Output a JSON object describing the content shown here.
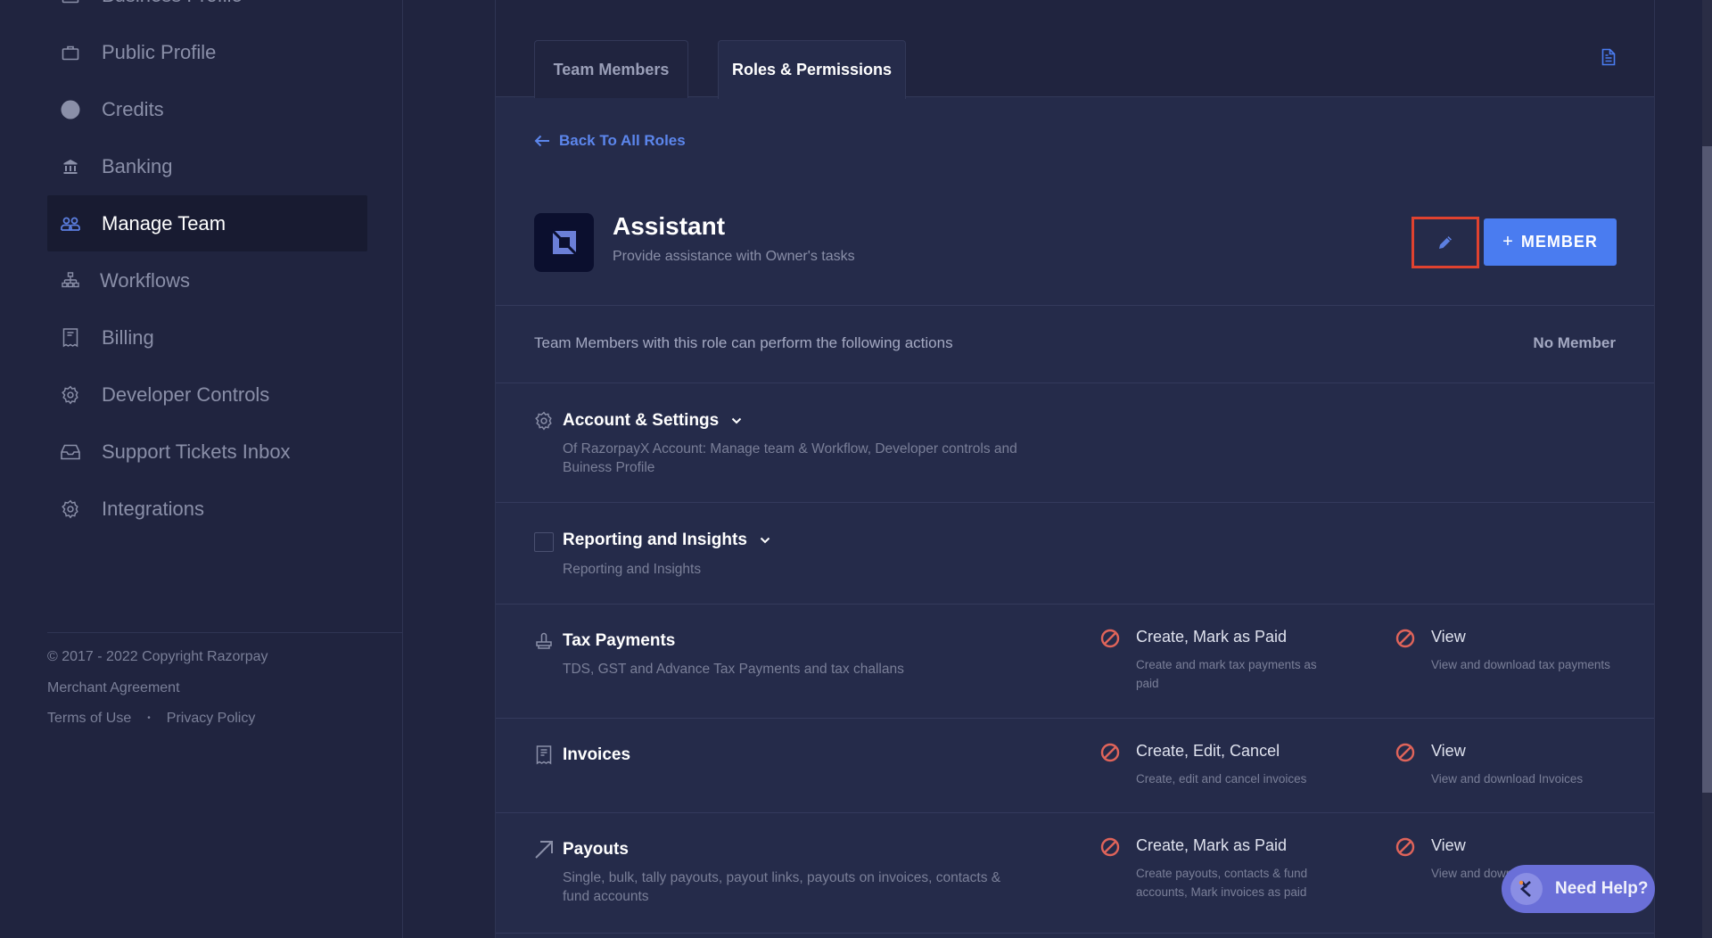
{
  "sidebar": {
    "items": [
      {
        "label": "Business Profile",
        "icon": "briefcase-icon",
        "active": false
      },
      {
        "label": "Public Profile",
        "icon": "briefcase-icon",
        "active": false
      },
      {
        "label": "Credits",
        "icon": "circle-icon",
        "active": false
      },
      {
        "label": "Banking",
        "icon": "bank-icon",
        "active": false
      },
      {
        "label": "Manage Team",
        "icon": "team-icon",
        "active": true
      },
      {
        "label": "Workflows",
        "icon": "hierarchy-icon",
        "active": false
      },
      {
        "label": "Billing",
        "icon": "receipt-icon",
        "active": false
      },
      {
        "label": "Developer Controls",
        "icon": "gear-icon",
        "active": false
      },
      {
        "label": "Support Tickets Inbox",
        "icon": "inbox-icon",
        "active": false
      },
      {
        "label": "Integrations",
        "icon": "gear-icon",
        "active": false
      }
    ],
    "footer": {
      "copyright": "© 2017 - 2022 Copyright Razorpay",
      "merchant_agreement": "Merchant Agreement",
      "terms": "Terms of Use",
      "separator": "•",
      "privacy": "Privacy Policy"
    }
  },
  "tabs": [
    {
      "label": "Team Members",
      "active": false
    },
    {
      "label": "Roles & Permissions",
      "active": true
    }
  ],
  "back_link": "Back To All Roles",
  "role": {
    "title": "Assistant",
    "subtitle": "Provide assistance with Owner's tasks",
    "add_member_label": "MEMBER",
    "add_member_prefix": "+"
  },
  "permissions_intro": {
    "text": "Team Members with this role can perform the following actions",
    "member_count": "No Member"
  },
  "sections": [
    {
      "title": "Account & Settings",
      "icon": "gear-icon",
      "expandable": true,
      "description": "Of RazorpayX Account: Manage team & Workflow, Developer controls and Buiness Profile"
    },
    {
      "title": "Reporting and Insights",
      "icon": "checkbox",
      "expandable": true,
      "description": "Reporting and Insights"
    },
    {
      "title": "Tax Payments",
      "icon": "stamp-icon",
      "description": "TDS, GST and Advance Tax Payments and tax challans",
      "permissions": [
        {
          "label": "Create, Mark as Paid",
          "description": "Create and mark tax payments as paid",
          "allowed": false
        },
        {
          "label": "View",
          "description": "View and download tax payments",
          "allowed": false
        }
      ]
    },
    {
      "title": "Invoices",
      "icon": "receipt-icon",
      "description": "",
      "permissions": [
        {
          "label": "Create, Edit, Cancel",
          "description": "Create, edit and cancel invoices",
          "allowed": false
        },
        {
          "label": "View",
          "description": "View and download Invoices",
          "allowed": false
        }
      ]
    },
    {
      "title": "Payouts",
      "icon": "arrow-up-right-icon",
      "description": "Single, bulk, tally payouts, payout links, payouts on invoices, contacts & fund accounts",
      "permissions": [
        {
          "label": "Create, Mark as Paid",
          "description": "Create payouts, contacts & fund accounts, Mark invoices as paid",
          "allowed": false
        },
        {
          "label": "View",
          "description": "View and download payouts",
          "allowed": false
        }
      ]
    }
  ],
  "help": {
    "label": "Need Help?"
  },
  "colors": {
    "accent": "#4a7cf0",
    "denied": "#e0645a",
    "highlight_outline": "#e0422f",
    "help_pill": "#6a6fd8"
  }
}
